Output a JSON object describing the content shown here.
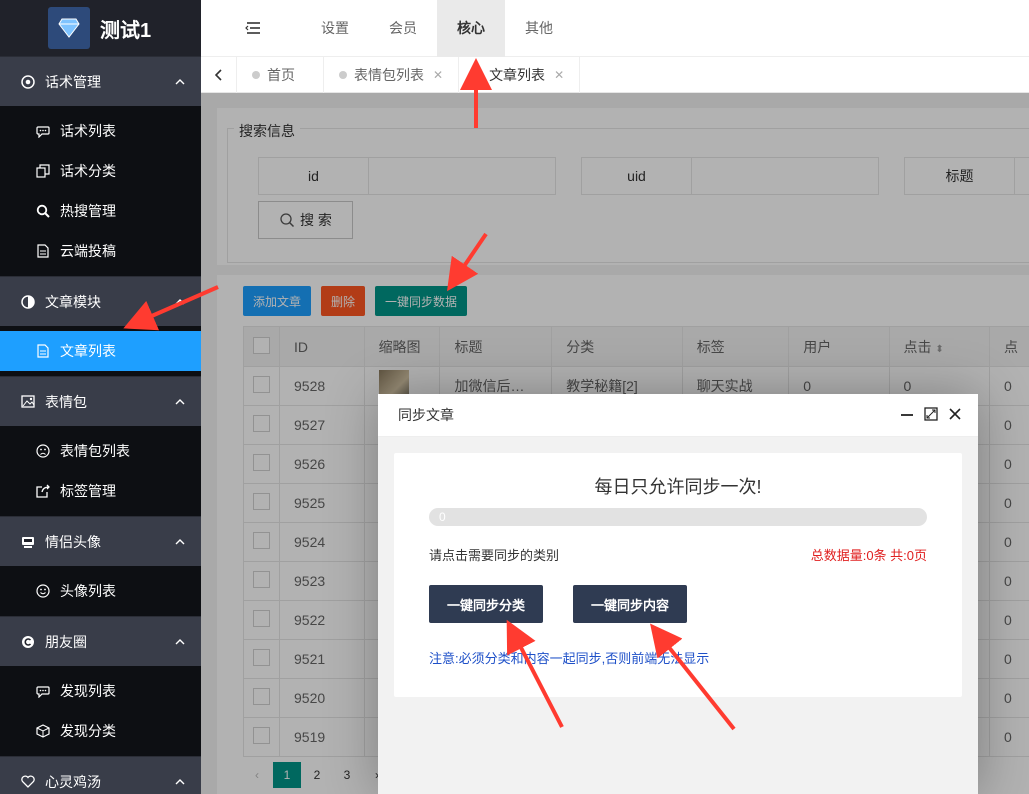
{
  "app": {
    "title": "测试1"
  },
  "topnav": {
    "items": [
      {
        "label": "设置",
        "active": false
      },
      {
        "label": "会员",
        "active": false
      },
      {
        "label": "核心",
        "active": true
      },
      {
        "label": "其他",
        "active": false
      }
    ]
  },
  "tabs": [
    {
      "label": "首页",
      "closable": false,
      "active": false
    },
    {
      "label": "表情包列表",
      "closable": true,
      "active": false
    },
    {
      "label": "文章列表",
      "closable": true,
      "active": true
    }
  ],
  "sidebar": {
    "groups": [
      {
        "label": "话术管理",
        "icon": "chrome-icon",
        "items": [
          {
            "label": "话术列表",
            "icon": "comment-icon"
          },
          {
            "label": "话术分类",
            "icon": "copy-icon"
          },
          {
            "label": "热搜管理",
            "icon": "search-icon"
          },
          {
            "label": "云端投稿",
            "icon": "file-icon"
          }
        ]
      },
      {
        "label": "文章模块",
        "icon": "half-circle-icon",
        "items": [
          {
            "label": "文章列表",
            "icon": "file-icon",
            "active": true
          }
        ]
      },
      {
        "label": "表情包",
        "icon": "image-icon",
        "items": [
          {
            "label": "表情包列表",
            "icon": "sad-face-icon"
          },
          {
            "label": "标签管理",
            "icon": "share-icon"
          }
        ]
      },
      {
        "label": "情侣头像",
        "icon": "user-group-icon",
        "items": [
          {
            "label": "头像列表",
            "icon": "smile-icon"
          }
        ]
      },
      {
        "label": "朋友圈",
        "icon": "c-icon",
        "items": [
          {
            "label": "发现列表",
            "icon": "comment-icon"
          },
          {
            "label": "发现分类",
            "icon": "cube-icon"
          }
        ]
      },
      {
        "label": "心灵鸡汤",
        "icon": "heart-icon",
        "items": []
      }
    ]
  },
  "search": {
    "legend": "搜索信息",
    "fields": [
      {
        "label": "id"
      },
      {
        "label": "uid"
      },
      {
        "label": "标题"
      }
    ],
    "button": "搜 索"
  },
  "toolbar": {
    "add": "添加文章",
    "delete": "删除",
    "sync": "一键同步数据"
  },
  "table": {
    "headers": [
      "",
      "ID",
      "缩略图",
      "标题",
      "分类",
      "标签",
      "用户",
      "点击",
      "点"
    ],
    "rows": [
      {
        "id": "9528",
        "title": "加微信后…",
        "category": "教学秘籍[2]",
        "tag": "聊天实战",
        "user": "0",
        "clicks": "0",
        "extra": "0"
      },
      {
        "id": "9527",
        "extra": "0"
      },
      {
        "id": "9526",
        "extra": "0"
      },
      {
        "id": "9525",
        "extra": "0"
      },
      {
        "id": "9524",
        "extra": "0"
      },
      {
        "id": "9523",
        "extra": "0"
      },
      {
        "id": "9522",
        "extra": "0"
      },
      {
        "id": "9521",
        "extra": "0"
      },
      {
        "id": "9520",
        "extra": "0"
      },
      {
        "id": "9519",
        "extra": "0"
      }
    ]
  },
  "pager": {
    "pages": [
      "1",
      "2",
      "3"
    ],
    "current": "1"
  },
  "modal": {
    "title": "同步文章",
    "heading": "每日只允许同步一次!",
    "progress": 0,
    "progress_text": "0",
    "hint": "请点击需要同步的类别",
    "total": "总数据量:0条 共:0页",
    "btn_category": "一键同步分类",
    "btn_content": "一键同步内容",
    "note": "注意:必须分类和内容一起同步,否则前端无法显示"
  },
  "colors": {
    "sidebar": "#20222a",
    "active": "#1e9fff",
    "arrow": "#ff3b30",
    "modal_button": "#2f3b52"
  }
}
